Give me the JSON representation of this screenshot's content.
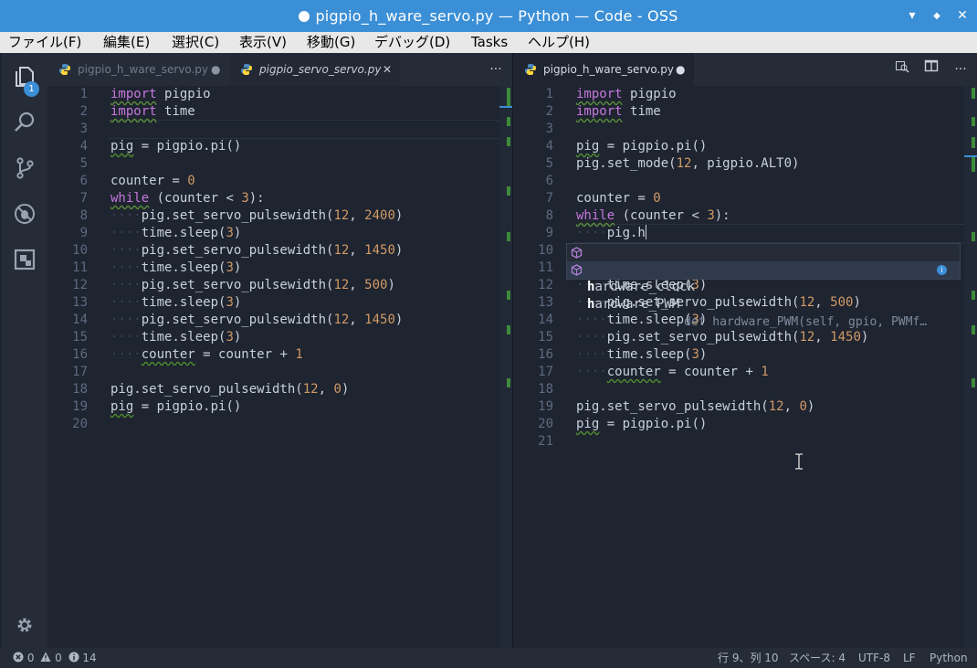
{
  "window": {
    "title": "pigpio_h_ware_servo.py — Python — Code - OSS",
    "minimize": "▾",
    "maximize": "◆",
    "close": "✕"
  },
  "menu": [
    "ファイル(F)",
    "編集(E)",
    "選択(C)",
    "表示(V)",
    "移動(G)",
    "デバッグ(D)",
    "Tasks",
    "ヘルプ(H)"
  ],
  "activity": {
    "explorer_badge": "1"
  },
  "left_group": {
    "tabs": [
      {
        "label": "pigpio_h_ware_servo.py",
        "mark": "●"
      },
      {
        "label": "pigpio_servo_servo.py",
        "mark": "✕"
      }
    ],
    "more": "···",
    "lines": [
      {
        "n": "1"
      },
      {
        "n": "2"
      },
      {
        "n": "3"
      },
      {
        "n": "4"
      },
      {
        "n": "5"
      },
      {
        "n": "6"
      },
      {
        "n": "7"
      },
      {
        "n": "8"
      },
      {
        "n": "9"
      },
      {
        "n": "10"
      },
      {
        "n": "11"
      },
      {
        "n": "12"
      },
      {
        "n": "13"
      },
      {
        "n": "14"
      },
      {
        "n": "15"
      },
      {
        "n": "16"
      },
      {
        "n": "17"
      },
      {
        "n": "18"
      },
      {
        "n": "19"
      },
      {
        "n": "20"
      }
    ]
  },
  "right_group": {
    "tabs": [
      {
        "label": "pigpio_h_ware_servo.py",
        "mark": "●"
      }
    ],
    "more": "···",
    "lines": [
      {
        "n": "1"
      },
      {
        "n": "2"
      },
      {
        "n": "3"
      },
      {
        "n": "4"
      },
      {
        "n": "5"
      },
      {
        "n": "6"
      },
      {
        "n": "7"
      },
      {
        "n": "8"
      },
      {
        "n": "9"
      },
      {
        "n": "10"
      },
      {
        "n": "11"
      },
      {
        "n": "12"
      },
      {
        "n": "13"
      },
      {
        "n": "14"
      },
      {
        "n": "15"
      },
      {
        "n": "16"
      },
      {
        "n": "17"
      },
      {
        "n": "18"
      },
      {
        "n": "19"
      },
      {
        "n": "20"
      },
      {
        "n": "21"
      }
    ]
  },
  "code": {
    "import_kw": "import",
    "pigpio_mod": "pigpio",
    "time_mod": "time",
    "pig_assign": "pig = pigpio.pi()",
    "pig_var": "pig",
    "pig_rest": " = pigpio.pi()",
    "set_mode_pre": "pig.set_mode(",
    "set_mode_post": ", pigpio.ALT0)",
    "counter_assign": "counter = ",
    "while_kw": "while",
    "while_cond": " (counter < ",
    "while_end": "):",
    "pulse_call": "pig.set_servo_pulsewidth(",
    "sep": ", ",
    "close": ")",
    "sleep_call": "time.sleep(",
    "counter_inc_lhs": "counter",
    "counter_inc_rhs": " = counter + ",
    "typing": "pig.h",
    "n0": "0",
    "n1": "1",
    "n3": "3",
    "n12": "12",
    "n2400": "2400",
    "n1450": "1450",
    "n500": "500"
  },
  "suggest": {
    "items": [
      {
        "match": "h",
        "rest": "ardware_clock",
        "detail": ""
      },
      {
        "match": "h",
        "rest": "ardware_PWM",
        "detail": "def hardware_PWM(self, gpio, PWMf…"
      }
    ],
    "info": "i"
  },
  "status": {
    "errors": "0",
    "warnings": "0",
    "infos": "14",
    "position": "行 9、列 10",
    "spaces": "スペース: 4",
    "encoding": "UTF-8",
    "eol": "LF",
    "language": "Python"
  },
  "colors": {
    "titlebar": "#3b8fd6",
    "editor_bg": "#1e2430",
    "keyword": "#c678dd",
    "number": "#d19a66",
    "git_added": "#3d8a3a"
  }
}
